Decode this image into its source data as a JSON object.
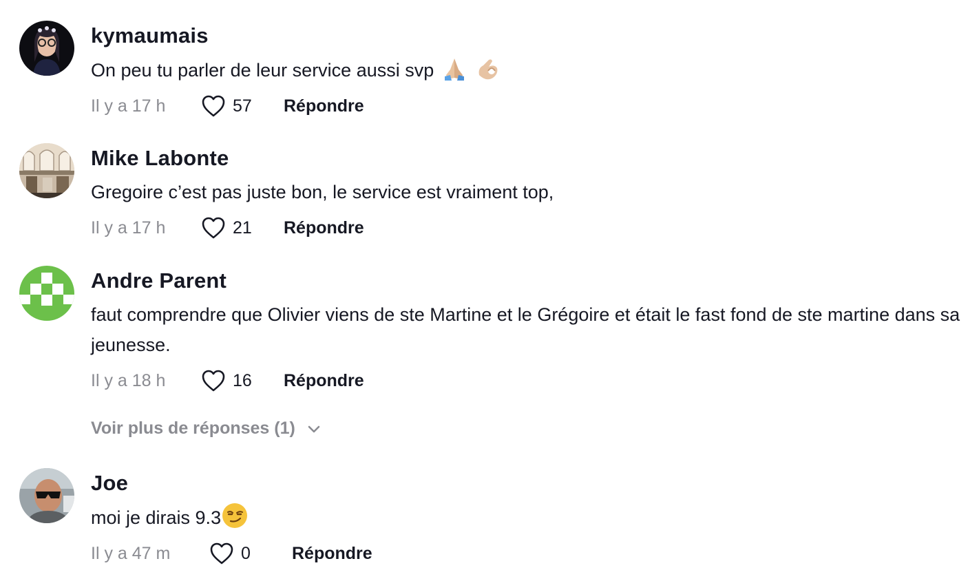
{
  "comments": [
    {
      "username": "kymaumais",
      "text": "On peu tu parler de leur service aussi svp",
      "time": "Il y a 17 h",
      "likes": "57",
      "reply_label": "Répondre",
      "emojis": [
        "folded-hands-emoji",
        "ok-hand-emoji"
      ]
    },
    {
      "username": "Mike Labonte",
      "text": "Gregoire c’est pas juste bon, le service est vraiment top,",
      "time": "Il y a 17 h",
      "likes": "21",
      "reply_label": "Répondre"
    },
    {
      "username": "Andre Parent",
      "text": "faut comprendre que Olivier viens de ste Martine et le Grégoire et était le fast fond de ste martine dans sa jeunesse.",
      "time": "Il y a 18 h",
      "likes": "16",
      "reply_label": "Répondre"
    },
    {
      "username": "Joe",
      "text": "moi je dirais 9.3",
      "time": "Il y a 47 m",
      "likes": "0",
      "reply_label": "Répondre",
      "emojis": [
        "smirking-face-emoji"
      ]
    }
  ],
  "more_replies": {
    "label": "Voir plus de réponses (1)"
  },
  "colors": {
    "text": "#161823",
    "muted": "#8a8b91",
    "andre_avatar": "#6cc04a"
  }
}
